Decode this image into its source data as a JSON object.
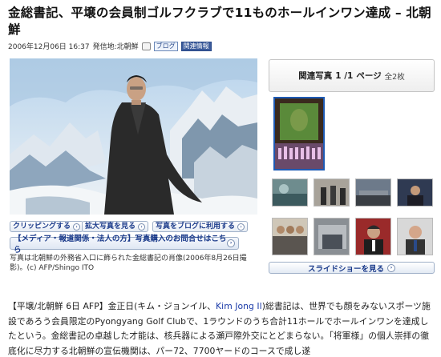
{
  "headline": "金総書記、平壌の会員制ゴルフクラブで11ものホールインワン達成 – 北朝鮮",
  "meta": {
    "datetime": "2006年12月06日 16:37",
    "origin": "発信地:北朝鮮",
    "blog_tag": "ブログ",
    "related_tag": "関連情報"
  },
  "photo_buttons": {
    "clipping": "クリッピングする",
    "enlarge": "拡大写真を見る",
    "blog_use": "写真をブログに利用する",
    "media_purchase": "【メディア・報道関係・法人の方】写真購入のお問合せはこちら"
  },
  "caption": "写真は北朝鮮の外務省入口に飾られた金総書記の肖像(2006年8月26日撮影)。(c) AFP/Shingo ITO",
  "related": {
    "label": "関連写真",
    "page": "1 /1",
    "page_suffix": "ページ",
    "total": "全2枚",
    "slideshow": "スライドショーを見る"
  },
  "article": {
    "p1": "【平壌/北朝鮮 6日 AFP】金正日(キム・ジョンイル、",
    "link": "Kim Jong Il",
    "p2": ")総書記は、世界でも顔をみないスポーツ施設であろう会員限定のPyongyang Golf Clubで、1ラウンドのうち合計11ホールでホールインワンを達成したという。金総書記の卓越した才能は、核兵器による瀬戸際外交にとどまらない。「将軍様」の個人崇拝の徹底化に尽力する北朝鮮の宣伝機関は、パー72、7700ヤードのコースで成し遂"
  },
  "icons": {
    "arrow": "›",
    "camera": "camera-icon"
  }
}
